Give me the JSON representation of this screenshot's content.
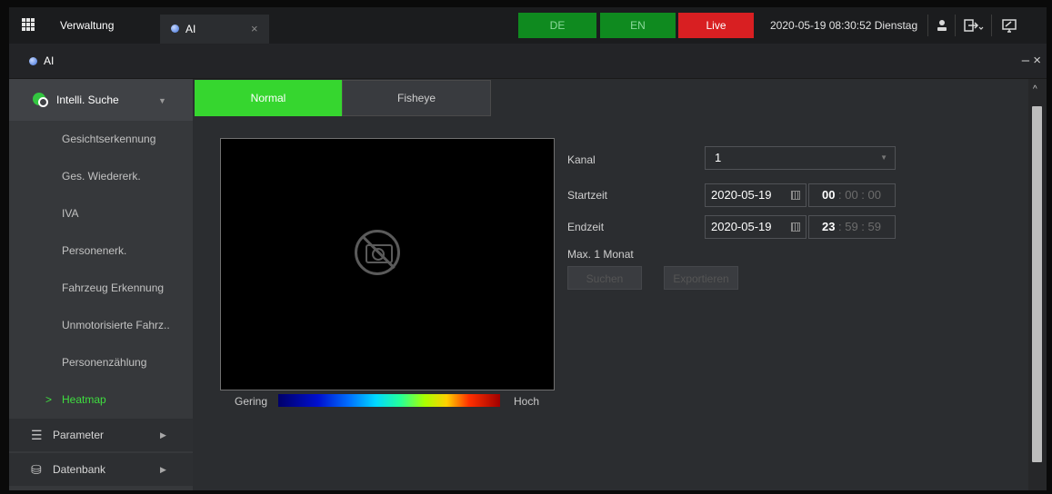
{
  "topbar": {
    "home_label": "Verwaltung",
    "tab_label": "AI",
    "tab_close": "×",
    "lang_de": "DE",
    "lang_en": "EN",
    "live_label": "Live",
    "datetime": "2020-05-19 08:30:52 Dienstag",
    "icons": [
      "apps-grid-icon",
      "user-icon",
      "logout-icon",
      "display-icon"
    ]
  },
  "window": {
    "title": "AI",
    "controls": "– ×"
  },
  "sidebar": {
    "header": "Intelli. Suche",
    "items": [
      {
        "label": "Gesichtserkennung"
      },
      {
        "label": "Ges. Wiedererk."
      },
      {
        "label": "IVA"
      },
      {
        "label": "Personenerk."
      },
      {
        "label": "Fahrzeug Erkennung"
      },
      {
        "label": "Unmotorisierte Fahrz.."
      },
      {
        "label": "Personenzählung"
      },
      {
        "label": "Heatmap",
        "active": true,
        "marker": ">"
      }
    ],
    "groups": [
      {
        "label": "Parameter"
      },
      {
        "label": "Datenbank"
      }
    ]
  },
  "tabs": {
    "normal": "Normal",
    "fisheye": "Fisheye"
  },
  "heatmap": {
    "legend_low": "Gering",
    "legend_high": "Hoch"
  },
  "form": {
    "kanal_label": "Kanal",
    "kanal_value": "1",
    "start_label": "Startzeit",
    "start_date": "2020-05-19",
    "start_hour": "00",
    "start_rest": ": 00 : 00",
    "end_label": "Endzeit",
    "end_date": "2020-05-19",
    "end_hour": "23",
    "end_rest": ": 59 : 59",
    "hint": "Max. 1 Monat",
    "search_btn": "Suchen",
    "export_btn": "Exportieren"
  }
}
